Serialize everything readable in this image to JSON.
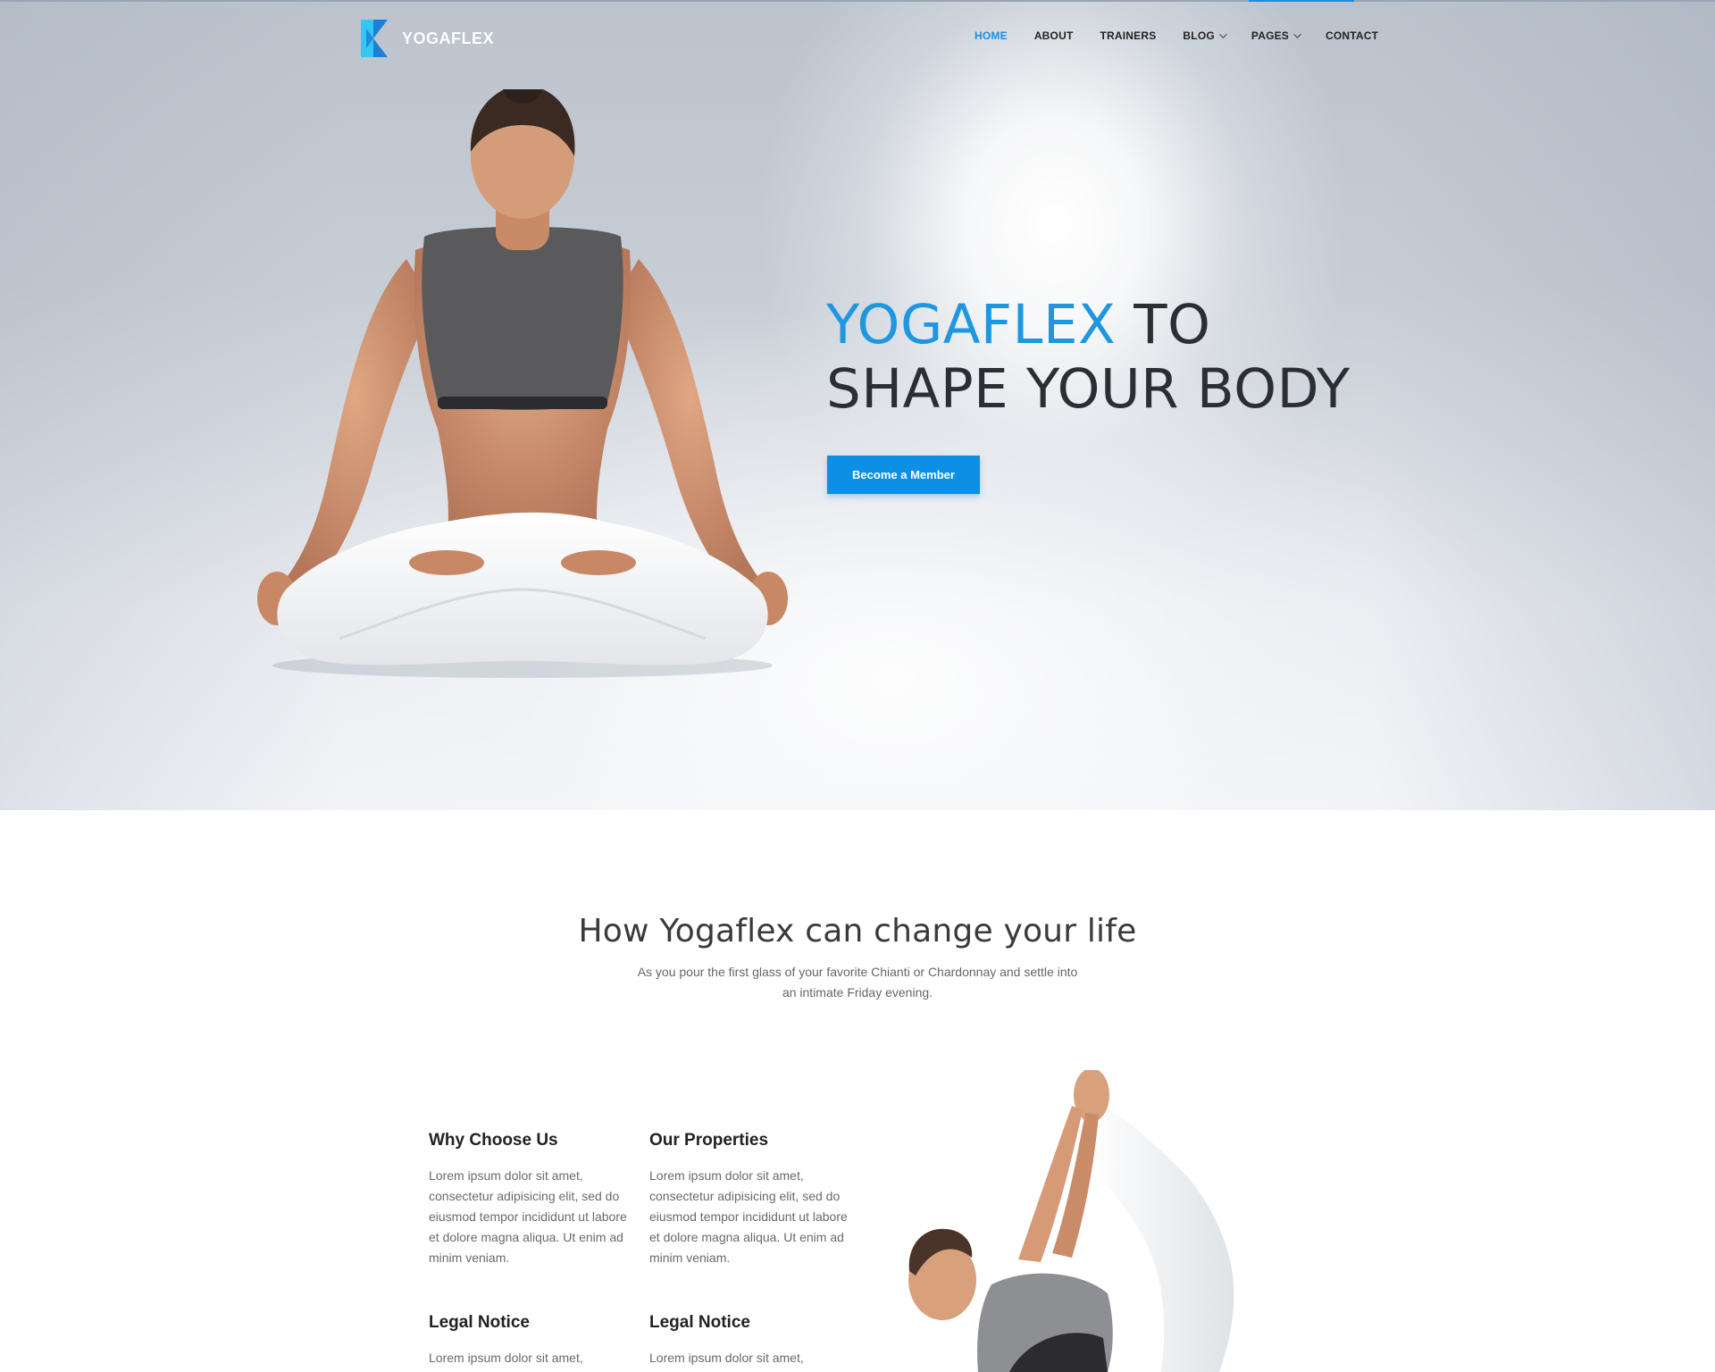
{
  "brand": {
    "name": "YOGAFLEX",
    "colors": {
      "accent": "#1a8fe0",
      "logo_light": "#35c6f2",
      "logo_dark": "#1d7fd6"
    }
  },
  "nav": {
    "items": [
      {
        "label": "HOME",
        "active": true
      },
      {
        "label": "ABOUT"
      },
      {
        "label": "TRAINERS"
      },
      {
        "label": "BLOG",
        "dropdown": true
      },
      {
        "label": "PAGES",
        "dropdown": true
      },
      {
        "label": "CONTACT"
      }
    ]
  },
  "hero": {
    "title_highlight": "YOGAFLEX",
    "title_rest_line1": " TO",
    "title_line2": "SHAPE YOUR BODY",
    "cta_label": "Become a Member"
  },
  "section": {
    "title": "How Yogaflex can change your life",
    "subtitle": "As you pour the first glass of your favorite Chianti or Chardonnay and settle into an intimate Friday evening."
  },
  "features": [
    {
      "title": "Why Choose Us",
      "text": "Lorem ipsum dolor sit amet, consectetur adipisicing elit, sed do eiusmod tempor incididunt ut labore et dolore magna aliqua. Ut enim ad minim veniam."
    },
    {
      "title": "Our Properties",
      "text": "Lorem ipsum dolor sit amet, consectetur adipisicing elit, sed do eiusmod tempor incididunt ut labore et dolore magna aliqua. Ut enim ad minim veniam."
    },
    {
      "title": "Legal Notice",
      "text": "Lorem ipsum dolor sit amet,"
    },
    {
      "title": "Legal Notice",
      "text": "Lorem ipsum dolor sit amet,"
    }
  ]
}
